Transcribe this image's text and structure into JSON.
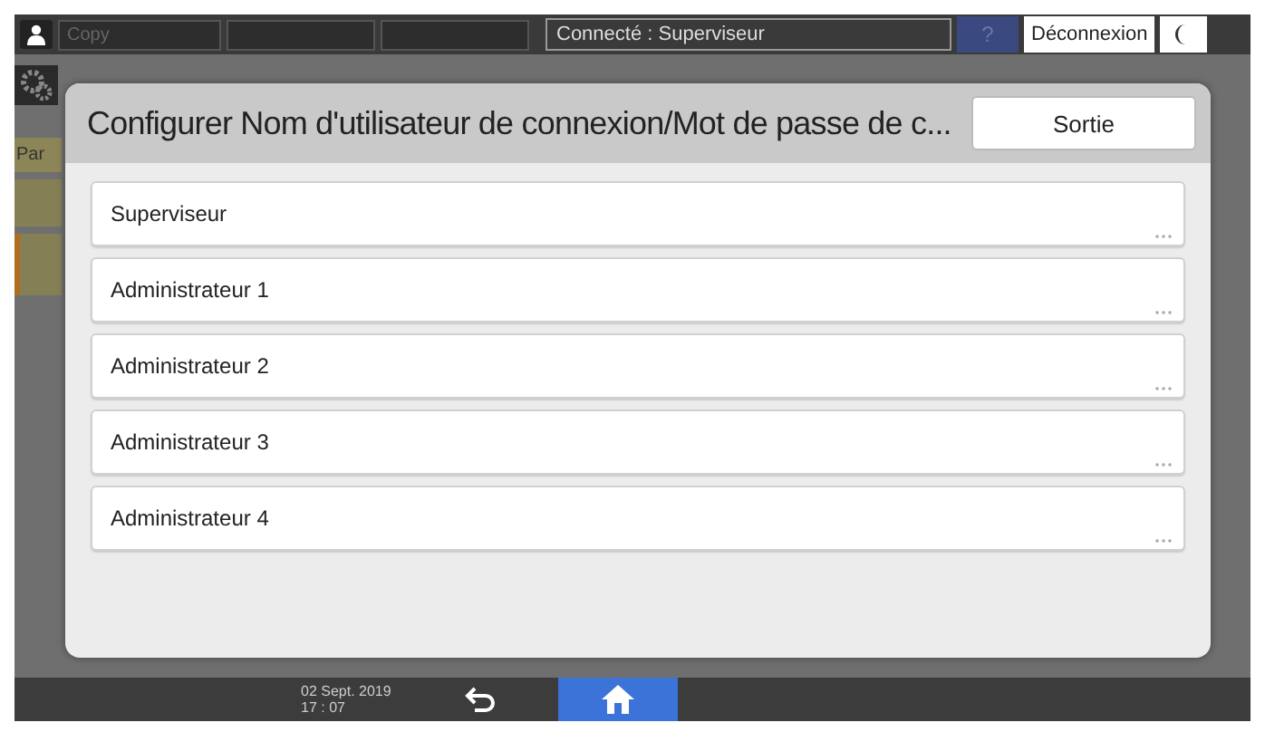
{
  "top_bar": {
    "app": "Copy",
    "login_status": "Connecté : Superviseur",
    "help": "?",
    "logout": "Déconnexion"
  },
  "background": {
    "panel_label": "Par"
  },
  "dialog": {
    "title": "Configurer Nom d'utilisateur de connexion/Mot de passe de c...",
    "exit": "Sortie",
    "items": [
      {
        "label": "Superviseur"
      },
      {
        "label": "Administrateur 1"
      },
      {
        "label": "Administrateur 2"
      },
      {
        "label": "Administrateur 3"
      },
      {
        "label": "Administrateur 4"
      }
    ]
  },
  "bottom_bar": {
    "date": "02 Sept. 2019",
    "time": "17 : 07"
  }
}
